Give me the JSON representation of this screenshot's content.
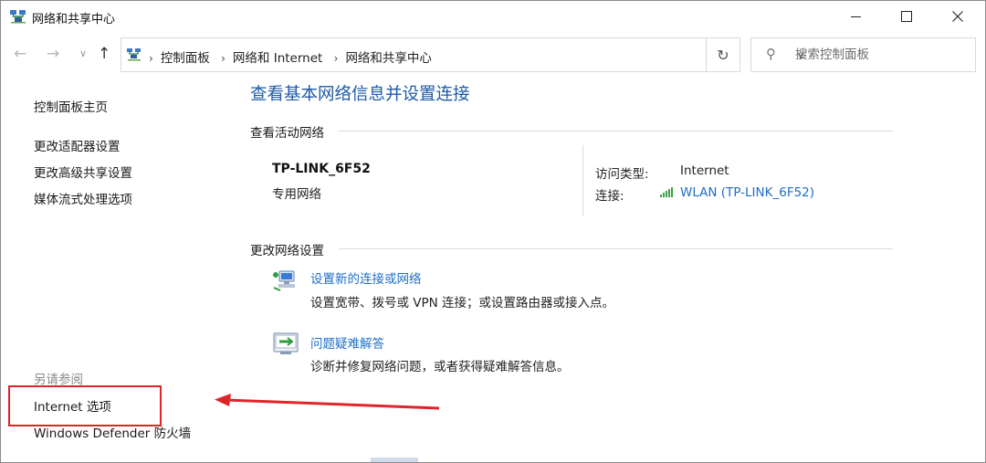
{
  "window": {
    "title": "网络和共享中心"
  },
  "nav": {
    "back_glyph": "←",
    "forward_glyph": "→",
    "recent_glyph": "∨",
    "up_glyph": "↑",
    "breadcrumbs": [
      "控制面板",
      "网络和 Internet",
      "网络和共享中心"
    ],
    "crumb_sep": "›",
    "dropdown_glyph": "∨",
    "refresh_glyph": "↻"
  },
  "search": {
    "placeholder": "搜索控制面板",
    "icon_glyph": "⚲"
  },
  "left_pane": {
    "links": [
      "控制面板主页",
      "更改适配器设置",
      "更改高级共享设置",
      "媒体流式处理选项"
    ],
    "see_also_label": "另请参阅",
    "see_also_links": [
      "Internet 选项",
      "Windows Defender 防火墙"
    ]
  },
  "main": {
    "title": "查看基本网络信息并设置连接",
    "active_networks": {
      "heading": "查看活动网络",
      "network_name": "TP-LINK_6F52",
      "network_category": "专用网络",
      "access_type_label": "访问类型:",
      "access_type_value": "Internet",
      "connections_label": "连接:",
      "connection_value": "WLAN (TP-LINK_6F52)"
    },
    "change_settings": {
      "heading": "更改网络设置",
      "tasks": [
        {
          "link": "设置新的连接或网络",
          "description": "设置宽带、拨号或 VPN 连接；或设置路由器或接入点。",
          "icon": "new-connection-icon"
        },
        {
          "link": "问题疑难解答",
          "description": "诊断并修复网络问题，或者获得疑难解答信息。",
          "icon": "troubleshoot-icon"
        }
      ]
    }
  },
  "colors": {
    "link_blue": "#1e6ec8",
    "title_blue": "#1e5aa8",
    "highlight_red": "#e0242a"
  }
}
